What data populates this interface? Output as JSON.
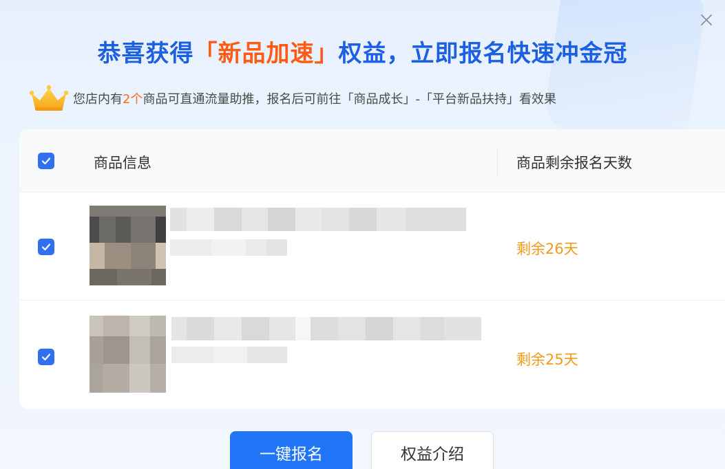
{
  "dialog": {
    "title_prefix": "恭喜获得",
    "title_highlight": "「新品加速」",
    "title_suffix": "权益，立即报名快速冲金冠",
    "subtitle_before": "您店内有",
    "subtitle_count": "2个",
    "subtitle_after": "商品可直通流量助推，报名后可前往「商品成长」-「平台新品扶持」看效果",
    "close_icon": "close-icon",
    "crown_icon": "crown-icon"
  },
  "table": {
    "select_all_checked": true,
    "col_info": "商品信息",
    "col_days": "商品剩余报名天数",
    "rows": [
      {
        "checked": true,
        "days": "剩余26天"
      },
      {
        "checked": true,
        "days": "剩余25天"
      }
    ]
  },
  "actions": {
    "primary_label": "一键报名",
    "secondary_label": "权益介绍"
  },
  "colors": {
    "title_blue": "#1c5fe0",
    "highlight_orange": "#ff5a14",
    "days_orange": "#f29a18",
    "primary_button": "#1f75f5",
    "checkbox_blue": "#2f6ff0"
  }
}
